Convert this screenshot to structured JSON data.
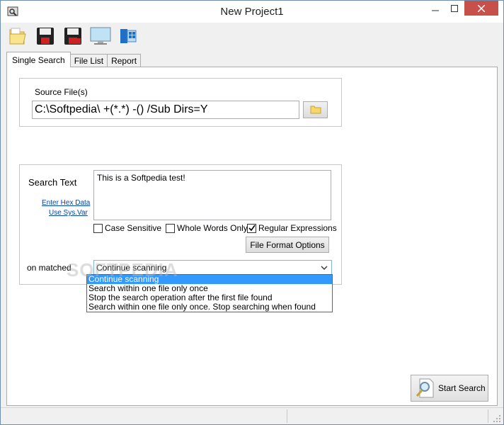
{
  "window": {
    "title": "New Project1"
  },
  "toolbar": {
    "items": [
      {
        "name": "open-folder-icon"
      },
      {
        "name": "save-icon"
      },
      {
        "name": "save-as-icon"
      },
      {
        "name": "monitor-icon"
      },
      {
        "name": "windows-icon"
      }
    ]
  },
  "tabs": [
    {
      "label": "Single Search",
      "active": true
    },
    {
      "label": "File List",
      "active": false
    },
    {
      "label": "Report",
      "active": false
    }
  ],
  "source": {
    "label": "Source File(s)",
    "value": "C:\\Softpedia\\ +(*.*) -() /Sub Dirs=Y"
  },
  "search": {
    "label": "Search  Text",
    "hex_link": "Enter Hex Data",
    "sysvar_link": "Use Sys.Var",
    "text": "This is a Softpedia test!",
    "case_sensitive": {
      "label": "Case Sensitive",
      "checked": false
    },
    "whole_words": {
      "label": "Whole Words Only",
      "checked": false
    },
    "regex": {
      "label": "Regular Expressions",
      "checked": true
    },
    "file_format_button": "File Format Options"
  },
  "matched": {
    "label": "on matched",
    "selected": "Continue scanning",
    "options": [
      "Continue scanning",
      "Search within one file only once",
      "Stop the search operation after the first file found",
      "Search within one file only once. Stop searching when found"
    ]
  },
  "start_button": "Start Search",
  "watermark": "SOFTPEDIA",
  "colors": {
    "selection": "#3399ff",
    "close": "#c7504b",
    "link": "#0645ad"
  }
}
